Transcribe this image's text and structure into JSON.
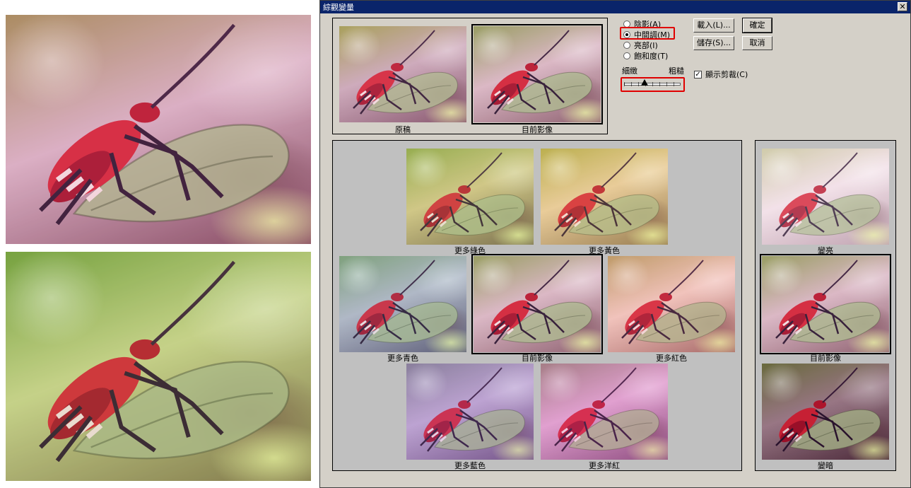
{
  "window": {
    "title": "綜觀變量",
    "close_icon": "close-icon"
  },
  "top_previews": [
    {
      "caption": "原稿",
      "tone": "t-orig"
    },
    {
      "caption": "目前影像",
      "tone": "t-var"
    }
  ],
  "range": {
    "options": [
      "陰影(A)",
      "中間調(M)",
      "亮部(I)",
      "飽和度(T)"
    ],
    "selected": "中間調(M)"
  },
  "slider": {
    "fine_label": "細緻",
    "coarse_label": "粗糙",
    "position": 0.3
  },
  "buttons": {
    "load": "載入(L)...",
    "ok": "確定",
    "save": "儲存(S)...",
    "cancel": "取消"
  },
  "show_clipping": {
    "label": "顯示剪裁(C)",
    "checked": true
  },
  "color_variations": [
    {
      "caption": "更多綠色",
      "tone": "t-green"
    },
    {
      "caption": "更多黃色",
      "tone": "t-yellow"
    },
    {
      "caption": "更多青色",
      "tone": "t-cyan"
    },
    {
      "caption": "目前影像",
      "tone": "t-var"
    },
    {
      "caption": "更多紅色",
      "tone": "t-red"
    },
    {
      "caption": "更多藍色",
      "tone": "t-blue"
    },
    {
      "caption": "更多洋紅",
      "tone": "t-mag"
    }
  ],
  "brightness_variations": [
    {
      "caption": "變亮",
      "tone": "t-light"
    },
    {
      "caption": "目前影像",
      "tone": "t-var"
    },
    {
      "caption": "變暗",
      "tone": "t-dark"
    }
  ]
}
